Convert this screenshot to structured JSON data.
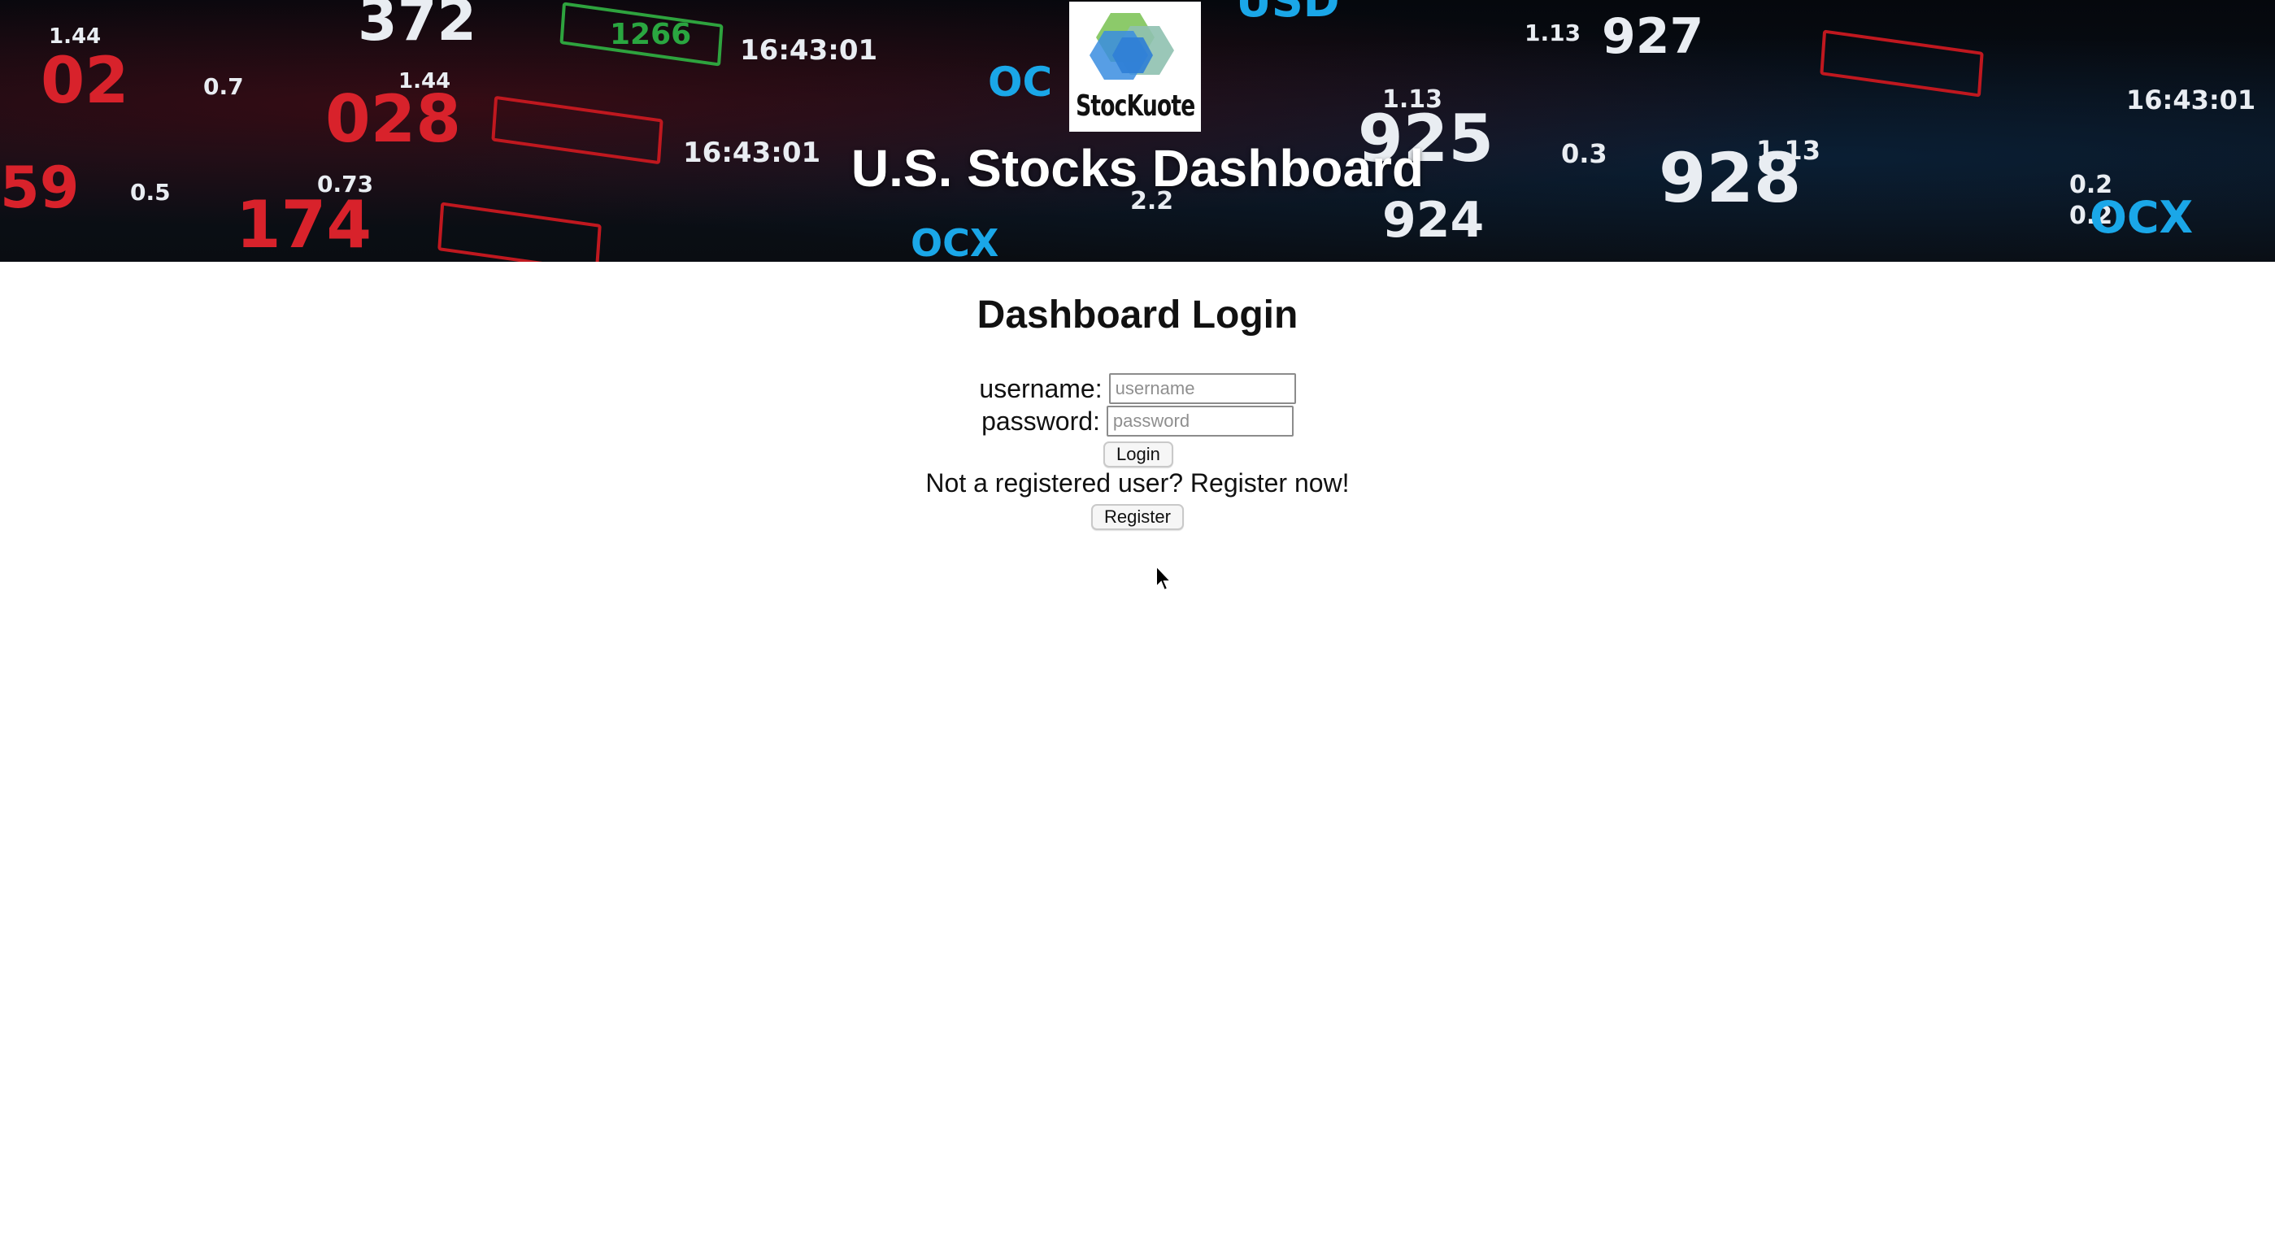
{
  "header": {
    "logo_text": "StocKuote",
    "title": "U.S. Stocks Dashboard"
  },
  "login": {
    "title": "Dashboard Login",
    "username_label": "username:",
    "username_placeholder": "username",
    "username_value": "",
    "password_label": "password:",
    "password_placeholder": "password",
    "password_value": "",
    "login_button": "Login",
    "register_prompt": "Not a registered user? Register now!",
    "register_button": "Register"
  },
  "icons": {
    "logo": "stockuote-logo-icon",
    "cursor": "mouse-pointer-icon"
  },
  "colors": {
    "banner_background": "#0a0d12",
    "ticker_red": "#d8222b",
    "ticker_blue": "#1aa7e8",
    "ticker_green": "#2aa640",
    "logo_blue": "#3a8de0",
    "logo_green": "#7fc45a",
    "logo_teal": "#8fc1b0"
  }
}
